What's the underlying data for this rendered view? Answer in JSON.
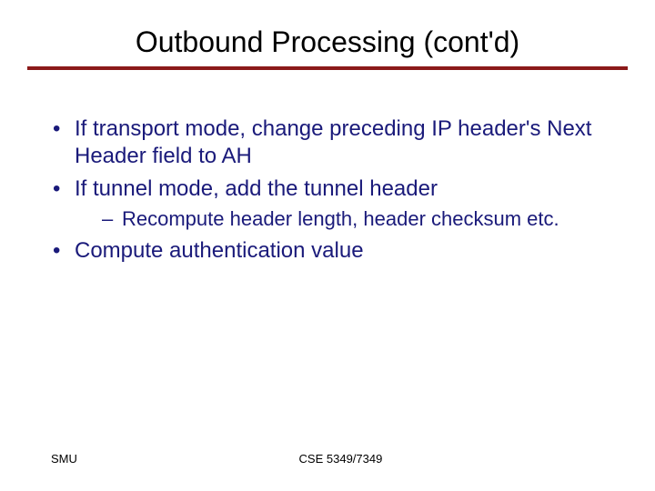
{
  "title": "Outbound Processing (cont'd)",
  "bullets": [
    {
      "text": "If transport mode, change preceding IP header's Next Header field to AH"
    },
    {
      "text": "If tunnel mode, add the tunnel header",
      "sub": [
        "Recompute header length, header checksum etc."
      ]
    },
    {
      "text": "Compute authentication value"
    }
  ],
  "footer": {
    "left": "SMU",
    "center": "CSE 5349/7349"
  }
}
